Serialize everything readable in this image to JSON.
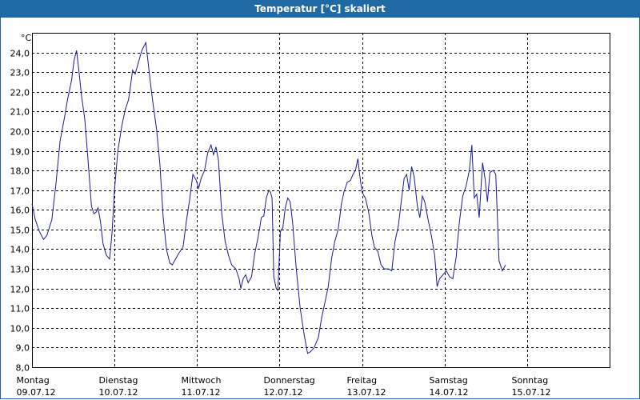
{
  "window": {
    "title": "Temperatur [°C] skaliert"
  },
  "chart_data": {
    "type": "line",
    "title": "Temperatur [°C] skaliert",
    "ylabel": "°C",
    "xlabel": "",
    "ylim": [
      8.0,
      25.0
    ],
    "yticks": [
      8.0,
      9.0,
      10.0,
      11.0,
      12.0,
      13.0,
      14.0,
      15.0,
      16.0,
      17.0,
      18.0,
      19.0,
      20.0,
      21.0,
      22.0,
      23.0,
      24.0
    ],
    "ytick_labels": [
      "8,0",
      "9,0",
      "10,0",
      "11,0",
      "12,0",
      "13,0",
      "14,0",
      "15,0",
      "16,0",
      "17,0",
      "18,0",
      "19,0",
      "20,0",
      "21,0",
      "22,0",
      "23,0",
      "24,0"
    ],
    "xlim": [
      0,
      7
    ],
    "day_labels": [
      {
        "day": "Montag",
        "date": "09.07.12"
      },
      {
        "day": "Dienstag",
        "date": "10.07.12"
      },
      {
        "day": "Mittwoch",
        "date": "11.07.12"
      },
      {
        "day": "Donnerstag",
        "date": "12.07.12"
      },
      {
        "day": "Freitag",
        "date": "13.07.12"
      },
      {
        "day": "Samstag",
        "date": "14.07.12"
      },
      {
        "day": "Sonntag",
        "date": "15.07.12"
      }
    ],
    "grid": true,
    "line_color": "#1a1aa0",
    "series": [
      {
        "values": [
          [
            0.0,
            16.3
          ],
          [
            0.04,
            15.5
          ],
          [
            0.09,
            14.9
          ],
          [
            0.14,
            14.5
          ],
          [
            0.18,
            14.7
          ],
          [
            0.24,
            15.5
          ],
          [
            0.29,
            17.3
          ],
          [
            0.34,
            19.5
          ],
          [
            0.39,
            20.6
          ],
          [
            0.43,
            21.6
          ],
          [
            0.48,
            22.6
          ],
          [
            0.51,
            23.6
          ],
          [
            0.54,
            24.1
          ],
          [
            0.57,
            23.0
          ],
          [
            0.6,
            21.8
          ],
          [
            0.64,
            20.6
          ],
          [
            0.68,
            18.5
          ],
          [
            0.72,
            16.2
          ],
          [
            0.75,
            15.8
          ],
          [
            0.78,
            15.9
          ],
          [
            0.8,
            16.1
          ],
          [
            0.83,
            15.4
          ],
          [
            0.86,
            14.3
          ],
          [
            0.9,
            13.7
          ],
          [
            0.94,
            13.5
          ],
          [
            0.97,
            14.8
          ],
          [
            1.0,
            17.0
          ],
          [
            1.04,
            19.0
          ],
          [
            1.09,
            20.3
          ],
          [
            1.13,
            21.1
          ],
          [
            1.17,
            21.6
          ],
          [
            1.2,
            22.5
          ],
          [
            1.22,
            23.1
          ],
          [
            1.25,
            22.9
          ],
          [
            1.29,
            23.5
          ],
          [
            1.33,
            24.1
          ],
          [
            1.38,
            24.5
          ],
          [
            1.41,
            23.4
          ],
          [
            1.44,
            22.3
          ],
          [
            1.47,
            21.3
          ],
          [
            1.51,
            20.1
          ],
          [
            1.55,
            18.3
          ],
          [
            1.59,
            15.6
          ],
          [
            1.63,
            14.0
          ],
          [
            1.67,
            13.3
          ],
          [
            1.7,
            13.2
          ],
          [
            1.74,
            13.5
          ],
          [
            1.78,
            13.8
          ],
          [
            1.83,
            14.1
          ],
          [
            1.87,
            15.4
          ],
          [
            1.91,
            16.5
          ],
          [
            1.95,
            17.8
          ],
          [
            1.99,
            17.5
          ],
          [
            2.02,
            17.1
          ],
          [
            2.05,
            17.6
          ],
          [
            2.09,
            18.0
          ],
          [
            2.13,
            18.9
          ],
          [
            2.17,
            19.3
          ],
          [
            2.2,
            18.8
          ],
          [
            2.23,
            19.2
          ],
          [
            2.26,
            18.5
          ],
          [
            2.3,
            15.8
          ],
          [
            2.34,
            14.4
          ],
          [
            2.38,
            13.7
          ],
          [
            2.42,
            13.2
          ],
          [
            2.47,
            13.0
          ],
          [
            2.51,
            12.5
          ],
          [
            2.53,
            12.0
          ],
          [
            2.56,
            12.5
          ],
          [
            2.59,
            12.7
          ],
          [
            2.62,
            12.3
          ],
          [
            2.66,
            12.6
          ],
          [
            2.7,
            13.8
          ],
          [
            2.74,
            14.6
          ],
          [
            2.78,
            15.6
          ],
          [
            2.81,
            15.7
          ],
          [
            2.84,
            16.6
          ],
          [
            2.87,
            17.0
          ],
          [
            2.89,
            16.9
          ],
          [
            2.91,
            16.6
          ],
          [
            2.93,
            12.6
          ],
          [
            2.96,
            12.0
          ],
          [
            2.98,
            11.9
          ],
          [
            3.01,
            14.9
          ],
          [
            3.04,
            15.1
          ],
          [
            3.07,
            16.1
          ],
          [
            3.1,
            16.6
          ],
          [
            3.13,
            16.4
          ],
          [
            3.16,
            15.3
          ],
          [
            3.2,
            13.1
          ],
          [
            3.25,
            11.0
          ],
          [
            3.3,
            9.6
          ],
          [
            3.34,
            8.7
          ],
          [
            3.38,
            8.8
          ],
          [
            3.42,
            9.0
          ],
          [
            3.47,
            9.5
          ],
          [
            3.51,
            10.5
          ],
          [
            3.55,
            11.3
          ],
          [
            3.59,
            12.1
          ],
          [
            3.63,
            13.5
          ],
          [
            3.67,
            14.4
          ],
          [
            3.71,
            15.0
          ],
          [
            3.75,
            16.3
          ],
          [
            3.78,
            16.9
          ],
          [
            3.82,
            17.4
          ],
          [
            3.86,
            17.5
          ],
          [
            3.89,
            17.8
          ],
          [
            3.92,
            18.0
          ],
          [
            3.95,
            18.6
          ],
          [
            3.97,
            17.8
          ],
          [
            4.0,
            16.9
          ],
          [
            4.04,
            16.6
          ],
          [
            4.08,
            15.9
          ],
          [
            4.12,
            14.7
          ],
          [
            4.15,
            14.1
          ],
          [
            4.19,
            13.9
          ],
          [
            4.23,
            13.2
          ],
          [
            4.27,
            13.0
          ],
          [
            4.32,
            13.0
          ],
          [
            4.36,
            12.9
          ],
          [
            4.4,
            14.4
          ],
          [
            4.44,
            15.2
          ],
          [
            4.48,
            16.6
          ],
          [
            4.51,
            17.6
          ],
          [
            4.54,
            17.8
          ],
          [
            4.57,
            17.0
          ],
          [
            4.6,
            18.2
          ],
          [
            4.63,
            17.7
          ],
          [
            4.67,
            16.2
          ],
          [
            4.7,
            15.6
          ],
          [
            4.73,
            16.7
          ],
          [
            4.76,
            16.4
          ],
          [
            4.8,
            15.5
          ],
          [
            4.84,
            14.7
          ],
          [
            4.88,
            13.7
          ],
          [
            4.91,
            12.1
          ],
          [
            4.94,
            12.5
          ],
          [
            4.98,
            12.7
          ],
          [
            5.02,
            12.9
          ],
          [
            5.06,
            12.6
          ],
          [
            5.1,
            12.5
          ],
          [
            5.14,
            13.6
          ],
          [
            5.18,
            15.4
          ],
          [
            5.22,
            16.7
          ],
          [
            5.26,
            17.2
          ],
          [
            5.3,
            18.0
          ],
          [
            5.33,
            19.3
          ],
          [
            5.36,
            16.6
          ],
          [
            5.39,
            16.8
          ],
          [
            5.42,
            15.6
          ],
          [
            5.44,
            17.0
          ],
          [
            5.46,
            18.4
          ],
          [
            5.49,
            17.6
          ],
          [
            5.52,
            16.4
          ],
          [
            5.55,
            17.9
          ],
          [
            5.59,
            18.0
          ],
          [
            5.62,
            17.8
          ],
          [
            5.66,
            13.4
          ],
          [
            5.7,
            12.9
          ],
          [
            5.74,
            13.2
          ]
        ]
      }
    ]
  }
}
